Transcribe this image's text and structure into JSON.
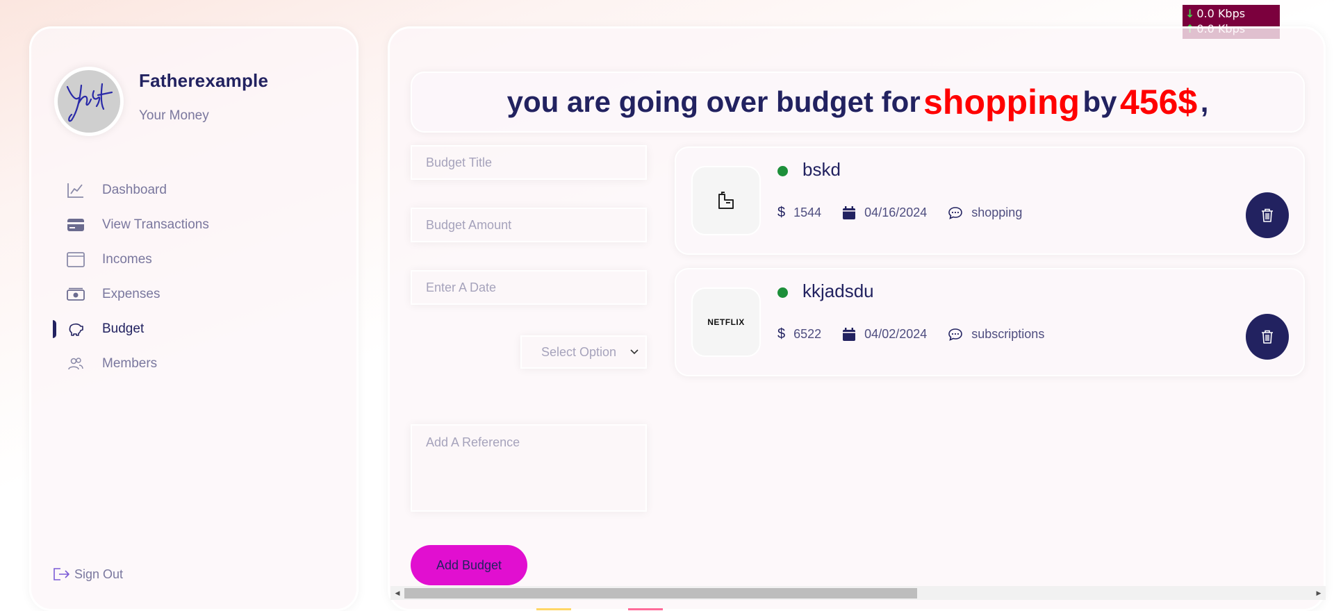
{
  "profile": {
    "name": "Fatherexample",
    "subtitle": "Your Money"
  },
  "sidebar": {
    "items": [
      {
        "label": "Dashboard",
        "icon": "chart-line-icon",
        "active": false
      },
      {
        "label": "View Transactions",
        "icon": "credit-card-icon",
        "active": false
      },
      {
        "label": "Incomes",
        "icon": "wallet-icon",
        "active": false
      },
      {
        "label": "Expenses",
        "icon": "money-bill-icon",
        "active": false
      },
      {
        "label": "Budget",
        "icon": "piggy-bank-icon",
        "active": true
      },
      {
        "label": "Members",
        "icon": "users-icon",
        "active": false
      }
    ],
    "signout_label": "Sign Out"
  },
  "banner": {
    "prefix": "you are going over budget for",
    "category": "shopping",
    "middle": "by",
    "amount": "456$",
    "suffix": ","
  },
  "form": {
    "title_placeholder": "Budget Title",
    "amount_placeholder": "Budget Amount",
    "date_placeholder": "Enter A Date",
    "select_placeholder": "Select Option",
    "reference_placeholder": "Add A Reference",
    "submit_label": "Add Budget"
  },
  "budgets": [
    {
      "title": "bskd",
      "amount": "1544",
      "date": "04/16/2024",
      "category": "shopping",
      "icon": "shopping-bag-icon"
    },
    {
      "title": "kkjadsdu",
      "amount": "6522",
      "date": "04/02/2024",
      "category": "subscriptions",
      "icon": "netflix-icon",
      "icon_text": "NETFLIX"
    }
  ],
  "currency_symbol": "$",
  "scrollbar": {
    "left_arrow": "◀",
    "right_arrow": "▶"
  },
  "network_monitor": {
    "down": "0.0 Kbps",
    "up": "0.0 Kbps",
    "down_arrow": "↓",
    "up_arrow": "↑"
  },
  "colors": {
    "primary": "#222260",
    "accent": "#e10fd0",
    "warning": "#ff0000",
    "status_dot": "#1d8f3a"
  }
}
